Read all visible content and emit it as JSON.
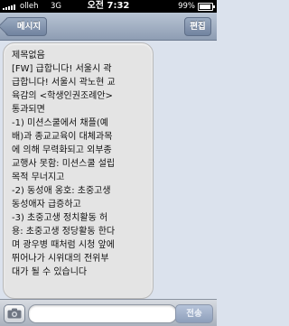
{
  "status_bar": {
    "carrier": "olleh",
    "network": "3G",
    "time": "오전 7:32",
    "battery_percent": "99%"
  },
  "nav": {
    "back_label": "메시지",
    "edit_label": "편집"
  },
  "message": {
    "text": "제목없음\n[FW] 급합니다! 서울시 곽\n급합니다! 서울시 곽노현 교\n육감의 <학생인권조례안>\n통과되면\n-1) 미션스쿨에서 채플(예\n배)과 종교교육이 대체과목\n에 의해 무력화되고 외부종\n교행사 못함: 미션스쿨 설립\n목적 무너지고\n-2) 동성애 옹호: 초중고생\n동성애자 급증하고\n-3) 초중고생 정치활동 허\n용: 초중고생 정당활동 한다\n며 광우병 때처럼 시청 앞에\n뛰어나가 시위대의 전위부\n대가 될 수 있습니다"
  },
  "input_bar": {
    "placeholder": "",
    "send_label": "전송"
  },
  "colors": {
    "status_bar_bg": "#000000",
    "nav_bar_bg": "#9aa9bf",
    "thread_bg": "#dbe2ed",
    "bubble_bg": "#e4e4e4"
  },
  "icons": {
    "camera": "camera-icon",
    "signal": "signal-bars-icon",
    "battery": "battery-icon"
  }
}
